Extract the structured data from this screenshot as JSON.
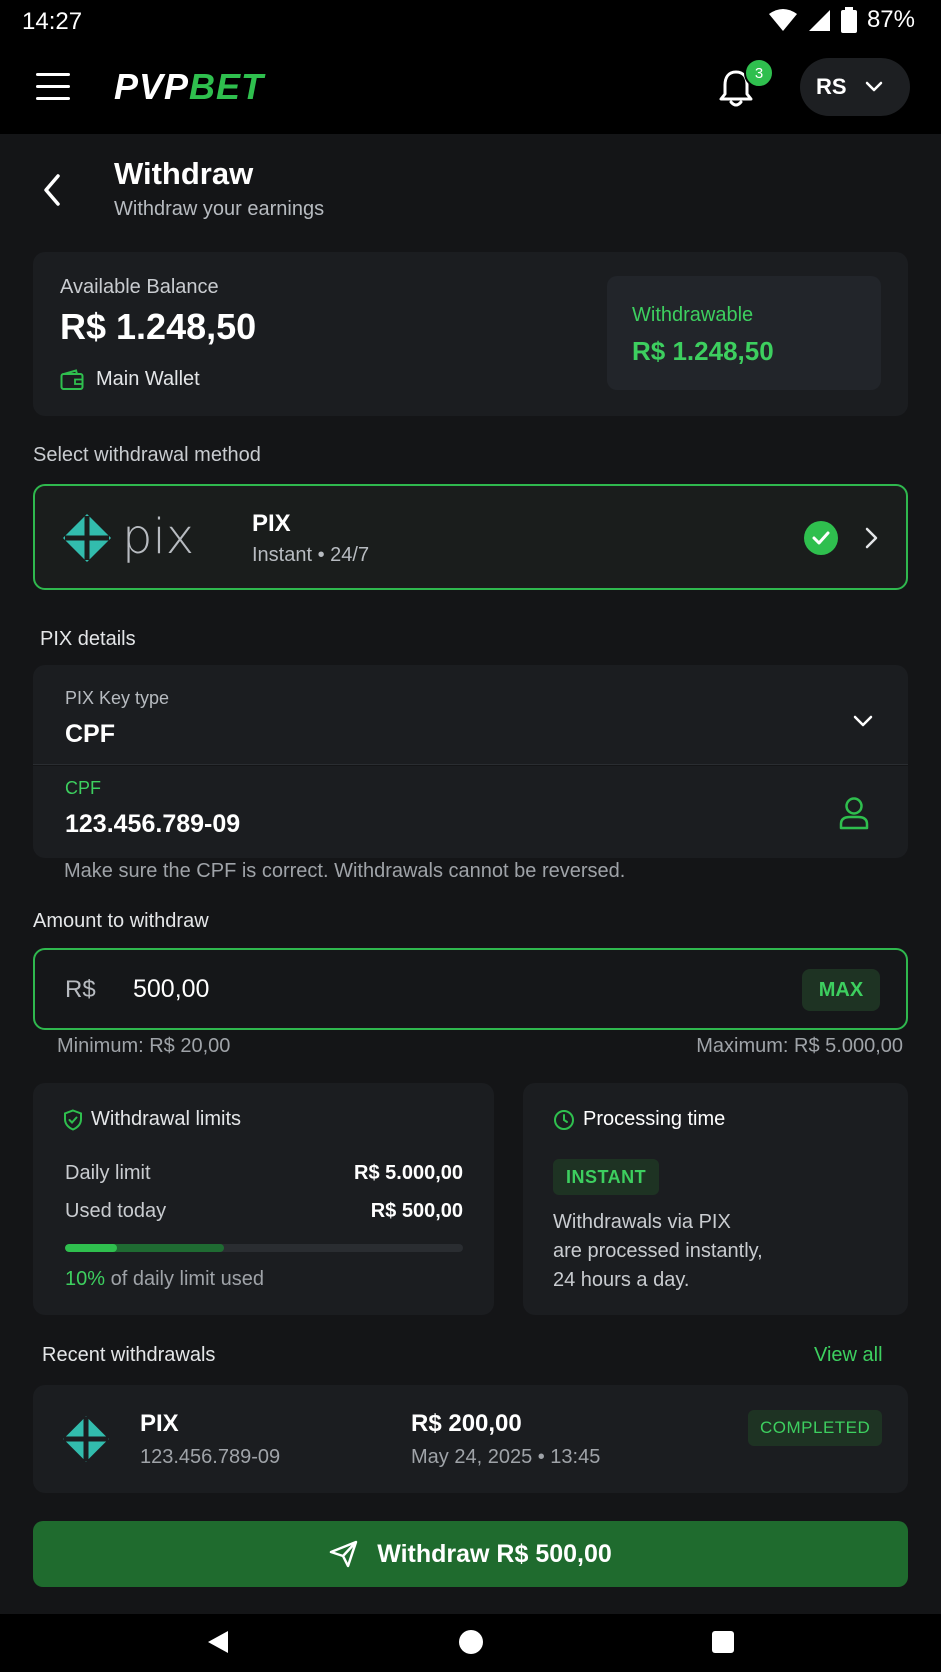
{
  "status_bar": {
    "time": "14:27",
    "battery": "87%"
  },
  "app_bar": {
    "logo_part1": "PVP",
    "logo_part2": "BET",
    "notification_count": "3",
    "user_initials": "RS"
  },
  "page": {
    "title": "Withdraw",
    "subtitle": "Withdraw your earnings"
  },
  "balance": {
    "label": "Available Balance",
    "value": "R$ 1.248,50",
    "wallet": "Main Wallet",
    "withdrawable_label": "Withdrawable",
    "withdrawable_value": "R$ 1.248,50"
  },
  "method": {
    "section_label": "Select withdrawal method",
    "logo_text": "pix",
    "name": "PIX",
    "detail": "Instant • 24/7"
  },
  "pix_details": {
    "section_label": "PIX details",
    "key_type_label": "PIX Key type",
    "key_type_value": "CPF",
    "cpf_label": "CPF",
    "cpf_value": "123.456.789-09",
    "help": "Make sure the CPF is correct. Withdrawals cannot be reversed."
  },
  "amount": {
    "section_label": "Amount to withdraw",
    "currency": "R$",
    "value": "500,00",
    "max_label": "MAX",
    "minimum": "Minimum: R$ 20,00",
    "maximum": "Maximum: R$ 5.000,00"
  },
  "limits": {
    "title": "Withdrawal limits",
    "daily_label": "Daily limit",
    "daily_value": "R$ 5.000,00",
    "used_label": "Used today",
    "used_value": "R$ 500,00",
    "used_percent": "10%",
    "used_percent_value": 0.1,
    "used_suffix": "of daily limit used"
  },
  "processing": {
    "title": "Processing time",
    "badge": "INSTANT",
    "line1": "Withdrawals via PIX",
    "line2": "are processed instantly,",
    "line3": "24 hours a day."
  },
  "recent": {
    "title": "Recent withdrawals",
    "view_all": "View all",
    "items": [
      {
        "method": "PIX",
        "key": "123.456.789-09",
        "amount": "R$ 200,00",
        "date": "May 24, 2025 • 13:45",
        "status": "COMPLETED"
      }
    ]
  },
  "cta": {
    "label": "Withdraw R$ 500,00"
  },
  "colors": {
    "accent": "#2fbf4e",
    "accent_text": "#3dcf5f",
    "cta_bg": "#1f6b2e",
    "pix_teal": "#32bcad",
    "background": "#141517"
  },
  "icons": [
    "menu-icon",
    "bell-icon",
    "chevron-down-icon",
    "back-icon",
    "wallet-icon",
    "pix-icon",
    "check-icon",
    "chevron-right-icon",
    "user-icon",
    "shield-icon",
    "clock-icon",
    "send-icon"
  ]
}
